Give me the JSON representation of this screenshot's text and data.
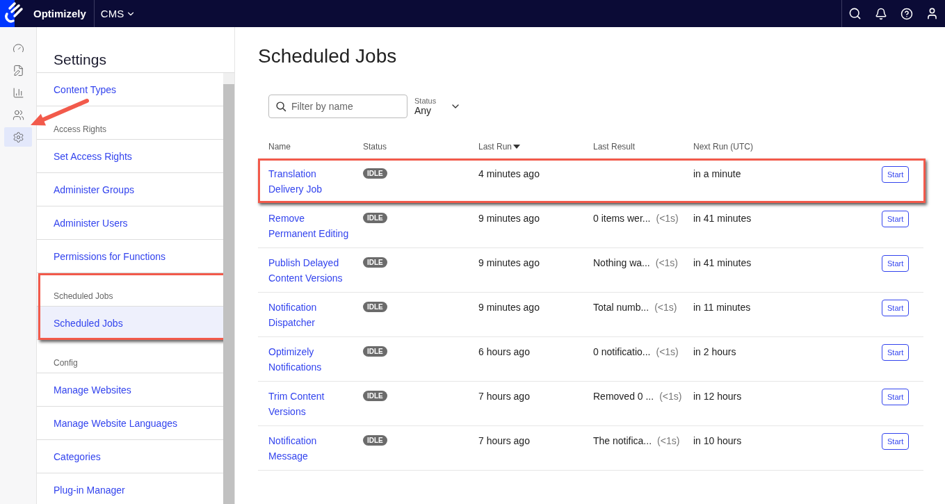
{
  "topbar": {
    "brand": "Optimizely",
    "product": "CMS"
  },
  "rail": [
    {
      "kind": "gauge",
      "selected": false,
      "arrow": false
    },
    {
      "kind": "edit",
      "selected": false,
      "arrow": false
    },
    {
      "kind": "chart",
      "selected": false,
      "arrow": false
    },
    {
      "kind": "users",
      "selected": false,
      "arrow": false
    },
    {
      "kind": "gear",
      "selected": true,
      "arrow": true
    }
  ],
  "settings": {
    "title": "Settings",
    "sections": [
      {
        "highlighted": false,
        "items": [
          {
            "label": "Content Types",
            "selected": false
          }
        ]
      },
      {
        "header": "Access Rights",
        "highlighted": false,
        "items": [
          {
            "label": "Set Access Rights",
            "selected": false
          },
          {
            "label": "Administer Groups",
            "selected": false
          },
          {
            "label": "Administer Users",
            "selected": false
          },
          {
            "label": "Permissions for Functions",
            "selected": false
          }
        ]
      },
      {
        "header": "Scheduled Jobs",
        "highlighted": true,
        "items": [
          {
            "label": "Scheduled Jobs",
            "selected": true
          }
        ]
      },
      {
        "header": "Config",
        "highlighted": false,
        "items": [
          {
            "label": "Manage Websites",
            "selected": false
          },
          {
            "label": "Manage Website Languages",
            "selected": false
          },
          {
            "label": "Categories",
            "selected": false
          },
          {
            "label": "Plug-in Manager",
            "selected": false
          }
        ]
      }
    ]
  },
  "main": {
    "title": "Scheduled Jobs",
    "filter": {
      "placeholder": "Filter by name"
    },
    "status_filter": {
      "label": "Status",
      "value": "Any"
    },
    "columns": [
      {
        "label": "Name",
        "sorted": false
      },
      {
        "label": "Status",
        "sorted": false
      },
      {
        "label": "Last Run",
        "sorted": true
      },
      {
        "label": "Last Result",
        "sorted": false
      },
      {
        "label": "Next Run (UTC)",
        "sorted": false
      }
    ],
    "rows": [
      {
        "name": "Translation Delivery Job",
        "status": "IDLE",
        "last_run": "4 minutes ago",
        "next_run": "in a minute",
        "action": "Start",
        "highlighted": true
      },
      {
        "name": "Remove Permanent Editing",
        "status": "IDLE",
        "last_run": "9 minutes ago",
        "last_result": "0 items wer...",
        "duration": "(<1s)",
        "next_run": "in 41 minutes",
        "action": "Start",
        "highlighted": false
      },
      {
        "name": "Publish Delayed Content Versions",
        "status": "IDLE",
        "last_run": "9 minutes ago",
        "last_result": "Nothing wa...",
        "duration": "(<1s)",
        "next_run": "in 41 minutes",
        "action": "Start",
        "highlighted": false
      },
      {
        "name": "Notification Dispatcher",
        "status": "IDLE",
        "last_run": "9 minutes ago",
        "last_result": "Total numb...",
        "duration": "(<1s)",
        "next_run": "in 11 minutes",
        "action": "Start",
        "highlighted": false
      },
      {
        "name": "Optimizely Notifications",
        "status": "IDLE",
        "last_run": "6 hours ago",
        "last_result": "0 notificatio...",
        "duration": "(<1s)",
        "next_run": "in 2 hours",
        "action": "Start",
        "highlighted": false
      },
      {
        "name": "Trim Content Versions",
        "status": "IDLE",
        "last_run": "7 hours ago",
        "last_result": "Removed 0 ...",
        "duration": "(<1s)",
        "next_run": "in 12 hours",
        "action": "Start",
        "highlighted": false
      },
      {
        "name": "Notification Message",
        "status": "IDLE",
        "last_run": "7 hours ago",
        "last_result": "The notifica...",
        "duration": "(<1s)",
        "next_run": "in 10 hours",
        "action": "Start",
        "highlighted": false
      }
    ]
  }
}
